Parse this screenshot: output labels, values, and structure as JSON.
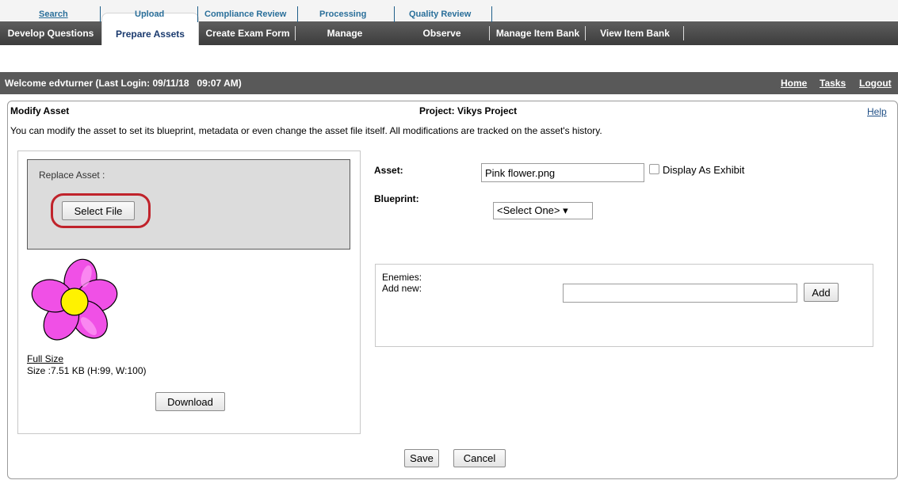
{
  "tabs": [
    {
      "label": "Develop Questions"
    },
    {
      "label": "Prepare Assets"
    },
    {
      "label": "Create Exam Form"
    },
    {
      "label": "Manage"
    },
    {
      "label": "Observe"
    },
    {
      "label": "Manage Item Bank"
    },
    {
      "label": "View Item Bank"
    }
  ],
  "subnav": [
    {
      "label": "Search"
    },
    {
      "label": "Upload"
    },
    {
      "label": "Compliance Review"
    },
    {
      "label": "Processing"
    },
    {
      "label": "Quality Review"
    }
  ],
  "welcome": {
    "message": "Welcome edvturner (Last Login: 09/11/18   09:07 AM)",
    "links": [
      "Home",
      "Tasks",
      "Logout"
    ]
  },
  "page": {
    "title": "Modify Asset",
    "project": "Project: Vikys Project",
    "help": "Help",
    "description": "You can modify the asset to set its blueprint, metadata or even change the asset file itself. All modifications are tracked on the asset's history."
  },
  "replace": {
    "label": "Replace Asset :",
    "select_file": "Select File"
  },
  "preview": {
    "full_size": "Full Size",
    "size": "Size :7.51 KB (H:99, W:100)",
    "download": "Download"
  },
  "form": {
    "asset_label": "Asset:",
    "asset_value": "Pink flower.png",
    "display_exhibit": "Display As Exhibit",
    "blueprint_label": "Blueprint:",
    "blueprint_value": "<Select One> ▾"
  },
  "enemies": {
    "label": "Enemies:",
    "add_new": "Add new:",
    "add_button": "Add"
  },
  "actions": {
    "save": "Save",
    "cancel": "Cancel"
  },
  "colors": {
    "tab_bar": "#4a4a4a",
    "welcome_bar": "#595959",
    "highlight": "#c0232b",
    "flower_petal": "#f050e6",
    "flower_center": "#fff200"
  }
}
